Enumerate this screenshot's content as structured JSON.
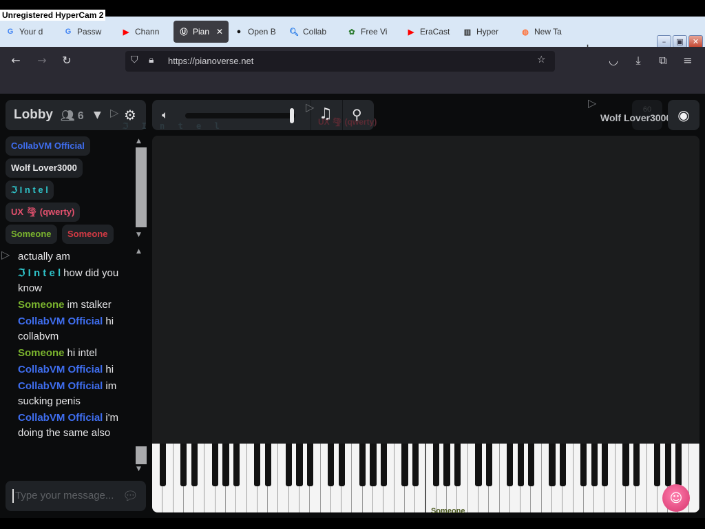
{
  "recorder": {
    "label": "Unregistered HyperCam 2"
  },
  "browser": {
    "tabs": [
      {
        "label": "Your d",
        "icon": "google-icon",
        "icon_color": "#4285f4"
      },
      {
        "label": "Passw",
        "icon": "google-icon",
        "icon_color": "#4285f4"
      },
      {
        "label": "Chann",
        "icon": "youtube-icon",
        "icon_color": "#ff0000"
      },
      {
        "label": "Pian",
        "icon": "pianoverse-icon",
        "icon_color": "#ffffff"
      },
      {
        "label": "Open B",
        "icon": "github-icon",
        "icon_color": "#111111"
      },
      {
        "label": "Collab",
        "icon": "search-icon",
        "icon_color": "#1a73e8"
      },
      {
        "label": "Free Vi",
        "icon": "virus-icon",
        "icon_color": "#2e7d32"
      },
      {
        "label": "EraCast",
        "icon": "youtube-icon",
        "icon_color": "#ff0000"
      },
      {
        "label": "Hyper",
        "icon": "archive-icon",
        "icon_color": "#333333"
      },
      {
        "label": "New Ta",
        "icon": "firefox-icon",
        "icon_color": "#ff7139"
      }
    ],
    "url": "https://pianoverse.net"
  },
  "app": {
    "lobby": {
      "name": "Lobby",
      "user_count": "6"
    },
    "users": [
      {
        "name": "CollabVM Official",
        "color": "#3f6ef0"
      },
      {
        "name": "Wolf Lover3000",
        "color": "#e9e9eb"
      },
      {
        "name": "ℑ I n t e l",
        "color": "#2fc3c9"
      },
      {
        "name": "UX 🌪 (qwerty)",
        "color": "#e4516e"
      },
      {
        "name": "Someone",
        "color": "#7ab32e"
      },
      {
        "name": "Someone",
        "color": "#d33a44"
      }
    ],
    "chat": [
      {
        "who": "",
        "color": "#e7e7e9",
        "text": "actually am"
      },
      {
        "who": "ℑ I n t e l",
        "color": "#2fc3c9",
        "text": "how did you know"
      },
      {
        "who": "Someone",
        "color": "#7ab32e",
        "text": "im stalker"
      },
      {
        "who": "CollabVM Official",
        "color": "#3f6ef0",
        "text": "hi collabvm"
      },
      {
        "who": "Someone",
        "color": "#7ab32e",
        "text": "hi intel"
      },
      {
        "who": "CollabVM Official",
        "color": "#3f6ef0",
        "text": "hi"
      },
      {
        "who": "CollabVM Official",
        "color": "#3f6ef0",
        "text": "im sucking penis"
      },
      {
        "who": "CollabVM Official",
        "color": "#3f6ef0",
        "text": "i'm doing the same also"
      }
    ],
    "chat_placeholder": "Type your message...",
    "ghosts": {
      "intel_tag": "ℑ I n t e l",
      "qwerty_tag": "UX 🌪 (qwerty)",
      "wolf_tag": "Wolf Lover3000",
      "someone_tag": "Someone"
    },
    "fps": "60",
    "volume": 0.97
  }
}
